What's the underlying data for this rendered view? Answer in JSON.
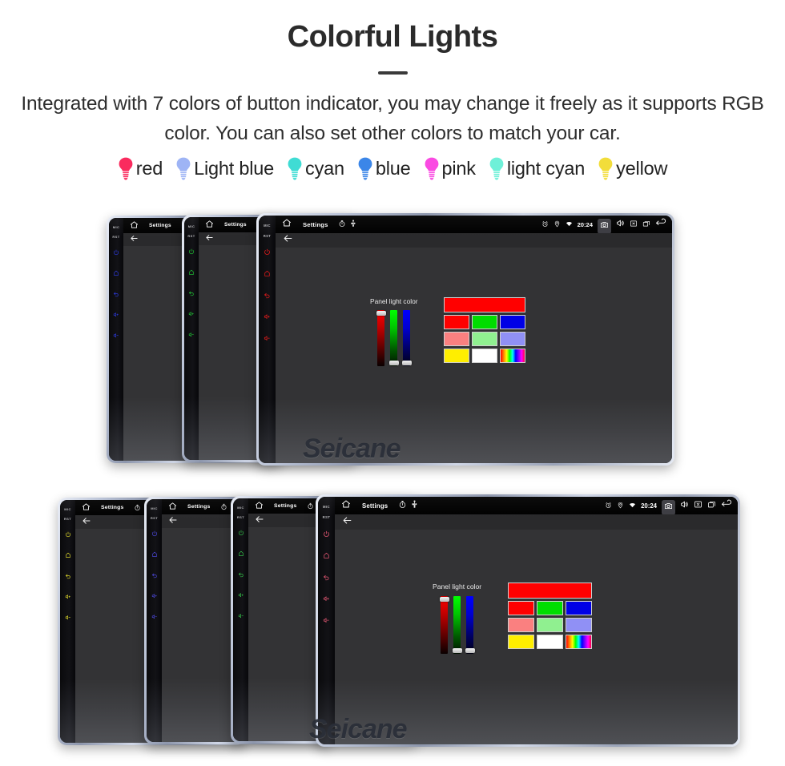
{
  "header": {
    "title": "Colorful Lights",
    "subtitle": "Integrated with 7 colors of button indicator, you may change it freely as it supports RGB color. You can also set other colors to match your car."
  },
  "legend": {
    "items": [
      {
        "label": "red",
        "color": "#fa2b5e"
      },
      {
        "label": "Light blue",
        "color": "#9eb4f5"
      },
      {
        "label": "cyan",
        "color": "#3fdcd4"
      },
      {
        "label": "blue",
        "color": "#3b86e8"
      },
      {
        "label": "pink",
        "color": "#fa4ae2"
      },
      {
        "label": "light cyan",
        "color": "#6ef0d8"
      },
      {
        "label": "yellow",
        "color": "#f2dd3a"
      }
    ]
  },
  "device_screen": {
    "statusbar": {
      "home_icon": "home-icon",
      "title": "Settings",
      "timer_icon": "stopwatch-icon",
      "usb_icon": "usb-icon",
      "alarm_icon": "alarm-clock-icon",
      "location_icon": "location-pin-icon",
      "wifi_icon": "wifi-icon",
      "clock": "20:24",
      "camera_icon": "camera-icon",
      "volume_icon": "speaker-icon",
      "close_icon": "close-box-icon",
      "recents_icon": "recents-icon",
      "back_icon": "back-arrow-icon"
    },
    "subbar": {
      "back_icon": "back-arrow-icon"
    },
    "picker": {
      "label": "Panel light color",
      "sliders": [
        {
          "name": "red-slider",
          "thumb": "top"
        },
        {
          "name": "green-slider",
          "thumb": "bottom"
        },
        {
          "name": "blue-slider",
          "thumb": "bottom"
        }
      ],
      "preview_color": "#ff0000",
      "swatch_rows": [
        [
          "#ff0000",
          "#00dd00",
          "#0000e6"
        ],
        [
          "#fa8080",
          "#90f090",
          "#9090f5"
        ],
        [
          "#ffee00",
          "#ffffff",
          "rainbow"
        ]
      ]
    }
  },
  "side_buttons": {
    "mic_label": "MIC",
    "rst_label": "RST",
    "icons": [
      "power-icon",
      "home-icon",
      "back-icon",
      "volume-up-icon",
      "volume-down-icon"
    ]
  },
  "groups": {
    "top": {
      "devices": [
        {
          "name": "device-top-blue",
          "led_color": "#2b39d8"
        },
        {
          "name": "device-top-green",
          "led_color": "#1fbd33"
        },
        {
          "name": "device-top-red",
          "led_color": "#e01a1a"
        }
      ]
    },
    "bottom": {
      "devices": [
        {
          "name": "device-bottom-yellow",
          "led_color": "#d8d32a"
        },
        {
          "name": "device-bottom-blue",
          "led_color": "#4b46d8"
        },
        {
          "name": "device-bottom-green",
          "led_color": "#32b846"
        },
        {
          "name": "device-bottom-pink",
          "led_color": "#e05570"
        }
      ]
    }
  },
  "watermark": {
    "text": "Seicane"
  }
}
